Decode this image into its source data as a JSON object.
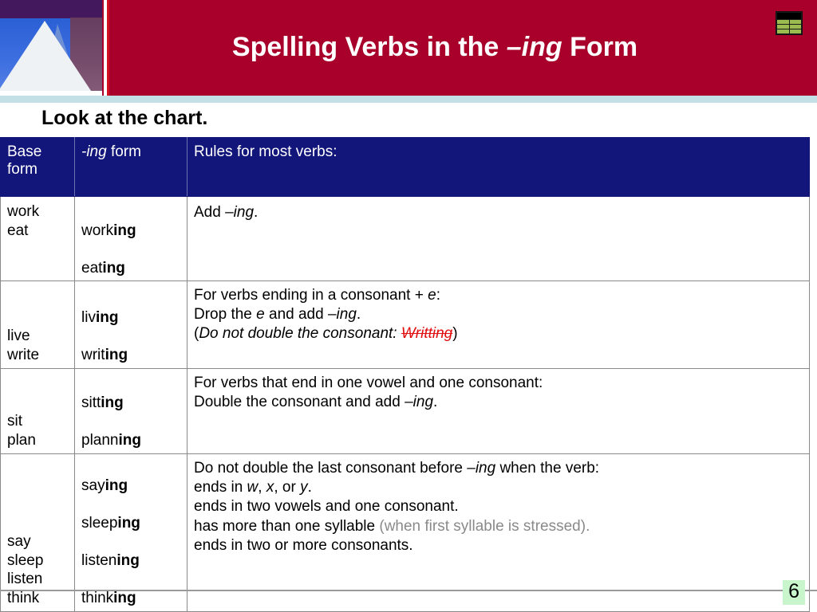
{
  "header": {
    "title_prefix": "Spelling Verbs in the ",
    "title_italic": "–ing",
    "title_suffix": " Form",
    "icon_name": "table-grid-icon",
    "band_color": "#a8002a",
    "separator_color": "#c3e0e6",
    "photo_name": "mountain-peak-photo"
  },
  "subtitle": "Look at the chart.",
  "table": {
    "header_bg": "#12167a",
    "columns": [
      {
        "label_line1": "Base",
        "label_line2": "form"
      },
      {
        "label_italic": "-ing",
        "label_rest": " form"
      },
      {
        "label": "Rules for most verbs:"
      }
    ],
    "rows": [
      {
        "base": "work\neat",
        "ing_plain_1": "work",
        "ing_bold_1": "ing",
        "ing_plain_2": "eat",
        "ing_bold_2": "ing",
        "rules": [
          {
            "parts": [
              {
                "t": "Add ",
                "s": "plain"
              },
              {
                "t": "–ing",
                "s": "ital"
              },
              {
                "t": ".",
                "s": "plain"
              }
            ]
          }
        ]
      },
      {
        "base": "live\nwrite",
        "ing_plain_1": "liv",
        "ing_bold_1": "ing",
        "ing_plain_2": "writ",
        "ing_bold_2": "ing",
        "rules": [
          {
            "parts": [
              {
                "t": "For verbs ending in a consonant + ",
                "s": "plain"
              },
              {
                "t": "e",
                "s": "ital"
              },
              {
                "t": ":",
                "s": "plain"
              }
            ]
          },
          {
            "parts": [
              {
                "t": "Drop the ",
                "s": "plain"
              },
              {
                "t": "e",
                "s": "ital"
              },
              {
                "t": " and add ",
                "s": "plain"
              },
              {
                "t": "–ing",
                "s": "ital"
              },
              {
                "t": ".",
                "s": "plain"
              }
            ]
          },
          {
            "parts": [
              {
                "t": "(",
                "s": "plain"
              },
              {
                "t": "Do not double the consonant: ",
                "s": "ital"
              },
              {
                "t": "Writting",
                "s": "strike-red"
              },
              {
                "t": ")",
                "s": "plain"
              }
            ]
          }
        ]
      },
      {
        "base": "sit\nplan",
        "ing_plain_1": "sitt",
        "ing_bold_1": "ing",
        "ing_plain_2": "plann",
        "ing_bold_2": "ing",
        "rules": [
          {
            "parts": [
              {
                "t": "For verbs that end in one vowel and one consonant:",
                "s": "plain"
              }
            ]
          },
          {
            "parts": [
              {
                "t": "Double the consonant and add ",
                "s": "plain"
              },
              {
                "t": "–ing",
                "s": "ital"
              },
              {
                "t": ".",
                "s": "plain"
              }
            ]
          }
        ]
      },
      {
        "base": "say\nsleep\nlisten\nthink",
        "ing_plain_1": "say",
        "ing_bold_1": "ing",
        "ing_plain_2": "sleep",
        "ing_bold_2": "ing",
        "ing_plain_3": "listen",
        "ing_bold_3": "ing",
        "ing_plain_4": "think",
        "ing_bold_4": "ing",
        "rules": [
          {
            "parts": [
              {
                "t": "Do not double the last consonant before ",
                "s": "plain"
              },
              {
                "t": "–ing",
                "s": "ital"
              },
              {
                "t": " when the verb:",
                "s": "plain"
              }
            ]
          },
          {
            "parts": [
              {
                "t": "ends in ",
                "s": "plain"
              },
              {
                "t": "w",
                "s": "ital"
              },
              {
                "t": ", ",
                "s": "plain"
              },
              {
                "t": "x",
                "s": "ital"
              },
              {
                "t": ", or ",
                "s": "plain"
              },
              {
                "t": "y",
                "s": "ital"
              },
              {
                "t": ".",
                "s": "plain"
              }
            ]
          },
          {
            "parts": [
              {
                "t": "ends in two vowels and one consonant.",
                "s": "plain"
              }
            ]
          },
          {
            "parts": [
              {
                "t": "has more than one syllable ",
                "s": "plain"
              },
              {
                "t": "(when first syllable is stressed).",
                "s": "gray"
              }
            ]
          },
          {
            "parts": [
              {
                "t": "ends in two or more consonants.",
                "s": "plain"
              }
            ]
          }
        ]
      }
    ]
  },
  "footer": {
    "page_number": "6",
    "page_number_highlight": "#c9f5cd"
  }
}
